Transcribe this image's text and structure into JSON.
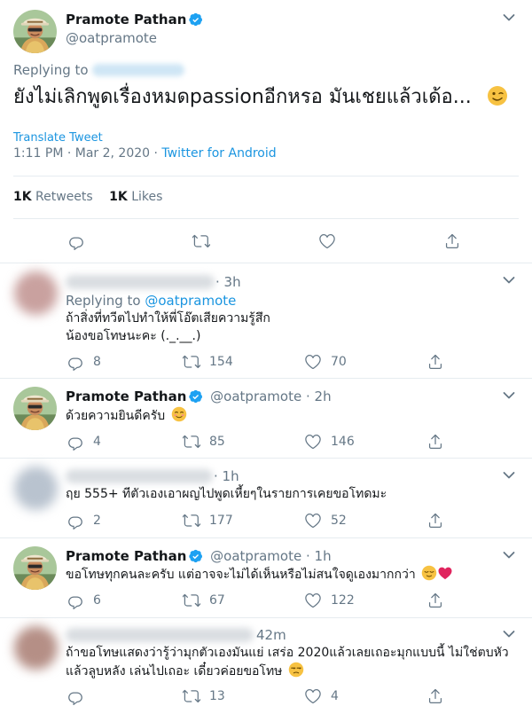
{
  "main_tweet": {
    "display_name": "Pramote Pathan",
    "handle": "@oatpramote",
    "replying_to_label": "Replying to",
    "text": "ยังไม่เลิกพูดเรื่องหมดpassionอีกหรอ มันเชยแล้วเด้อ...",
    "translate_label": "Translate Tweet",
    "timestamp": "1:11 PM · Mar 2, 2020 · ",
    "source": "Twitter for Android",
    "retweets_count": "1K",
    "retweets_label": "Retweets",
    "likes_count": "1K",
    "likes_label": "Likes"
  },
  "replies": [
    {
      "time": "· 3h",
      "replying_to_label": "Replying to",
      "replying_to_handle": "@oatpramote",
      "line1": "ถ้าสิ่งที่ทวีตไปทำให้พี่โอ๊ตเสียความรู้สึก",
      "line2": "น้องขอโทษนะคะ (._.__.)",
      "replies": "8",
      "retweets": "154",
      "likes": "70"
    },
    {
      "display_name": "Pramote Pathan",
      "handle": "@oatpramote",
      "time": "· 2h",
      "line1": "ด้วยความยินดีครับ",
      "replies": "4",
      "retweets": "85",
      "likes": "146"
    },
    {
      "time": "· 1h",
      "line1": "ฤย 555+ ทีตัวเองเอาผญไปพูดเหี้ยๆในรายการเคยขอโทดมะ",
      "replies": "2",
      "retweets": "177",
      "likes": "52"
    },
    {
      "display_name": "Pramote Pathan",
      "handle": "@oatpramote",
      "time": "· 1h",
      "line1": "ขอโทษทุกคนละครับ แต่อาจจะไม่ได้เห็นหรือไม่สนใจดูเองมากกว่า",
      "replies": "6",
      "retweets": "67",
      "likes": "122"
    },
    {
      "time": "42m",
      "line1": "ถ้าขอโทษแสดงว่ารู้ว่ามุกตัวเองมันแย่ เสร่อ 2020แล้วเลยเถอะมุกแบบนี้ ไม่ใช่ตบหัว",
      "line2": "แล้วลูบหลัง เล่นไปเถอะ เดี๋ยวค่อยขอโทษ",
      "replies": "",
      "retweets": "13",
      "likes": "4"
    }
  ],
  "icons": {
    "reply": "reply-icon",
    "retweet": "retweet-icon",
    "like": "heart-icon",
    "share": "share-icon",
    "verified": "verified-badge-icon",
    "more": "chevron-down-icon"
  },
  "colors": {
    "link": "#1b95e0",
    "secondary": "#657786",
    "verified": "#1da1f2",
    "divider": "#e6ecf0",
    "heart_emoji": "#e0245e"
  }
}
